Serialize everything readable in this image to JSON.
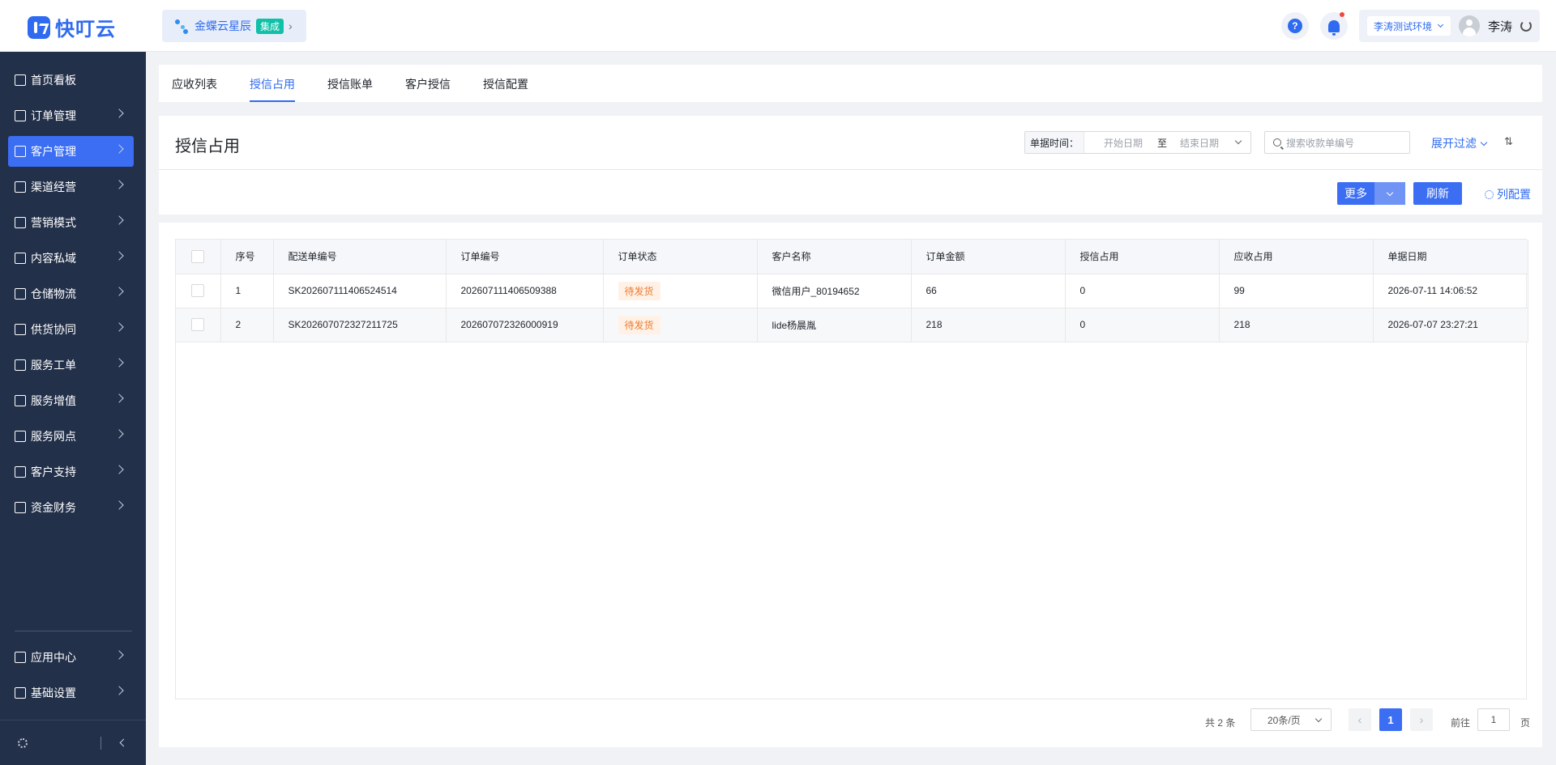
{
  "app": {
    "brand": "快叮云"
  },
  "integration": {
    "name": "金蝶云星辰",
    "badge": "集成"
  },
  "header": {
    "help_icon": "?",
    "environment": "李涛测试环境",
    "user_name": "李涛"
  },
  "sidebar": {
    "items": [
      {
        "label": "首页看板",
        "icon": "home-icon",
        "active": false,
        "has_children": false
      },
      {
        "label": "订单管理",
        "icon": "order-icon",
        "active": false,
        "has_children": true
      },
      {
        "label": "客户管理",
        "icon": "user-icon",
        "active": true,
        "has_children": true
      },
      {
        "label": "渠道经营",
        "icon": "channel-icon",
        "active": false,
        "has_children": true
      },
      {
        "label": "营销模式",
        "icon": "tag-icon",
        "active": false,
        "has_children": true
      },
      {
        "label": "内容私域",
        "icon": "image-icon",
        "active": false,
        "has_children": true
      },
      {
        "label": "仓储物流",
        "icon": "warehouse-icon",
        "active": false,
        "has_children": true
      },
      {
        "label": "供货协同",
        "icon": "supply-icon",
        "active": false,
        "has_children": true
      },
      {
        "label": "服务工单",
        "icon": "workorder-icon",
        "active": false,
        "has_children": true
      },
      {
        "label": "服务增值",
        "icon": "bag-icon",
        "active": false,
        "has_children": true
      },
      {
        "label": "服务网点",
        "icon": "store-icon",
        "active": false,
        "has_children": true
      },
      {
        "label": "客户支持",
        "icon": "support-icon",
        "active": false,
        "has_children": true
      },
      {
        "label": "资金财务",
        "icon": "yuan-icon",
        "active": false,
        "has_children": true
      }
    ],
    "bottom_items": [
      {
        "label": "应用中心",
        "icon": "cube-icon"
      },
      {
        "label": "基础设置",
        "icon": "settings-list-icon"
      }
    ]
  },
  "tabs": [
    {
      "label": "应收列表",
      "active": false
    },
    {
      "label": "授信占用",
      "active": true
    },
    {
      "label": "授信账单",
      "active": false
    },
    {
      "label": "客户授信",
      "active": false
    },
    {
      "label": "授信配置",
      "active": false
    }
  ],
  "page": {
    "title": "授信占用",
    "date_label": "单据时间：",
    "date_start_placeholder": "开始日期",
    "date_separator": "至",
    "date_end_placeholder": "结束日期",
    "search_placeholder": "搜索收款单编号",
    "expand_filter": "展开过滤",
    "more_button": "更多",
    "refresh_button": "刷新",
    "column_config": "列配置"
  },
  "table": {
    "columns": [
      "序号",
      "配送单编号",
      "订单编号",
      "订单状态",
      "客户名称",
      "订单金额",
      "授信占用",
      "应收占用",
      "单据日期"
    ],
    "rows": [
      {
        "index": "1",
        "delivery_no": "SK202607111406524514",
        "order_no": "202607111406509388",
        "status": "待发货",
        "customer": "微信用户_80194652",
        "amount": "66",
        "credit": "0",
        "receivable": "99",
        "date": "2026-07-11 14:06:52"
      },
      {
        "index": "2",
        "delivery_no": "SK202607072327211725",
        "order_no": "202607072326000919",
        "status": "待发货",
        "customer": "lide杨晨胤",
        "amount": "218",
        "credit": "0",
        "receivable": "218",
        "date": "2026-07-07 23:27:21"
      }
    ]
  },
  "pagination": {
    "total_text": "共 2 条",
    "page_size": "20条/页",
    "prev": "‹",
    "current_page": "1",
    "next": "›",
    "goto_label": "前往",
    "goto_value": "1",
    "page_suffix": "页"
  },
  "colors": {
    "primary": "#3b6ef2",
    "sidebar_bg": "#23304a",
    "status_orange": "#ed7b2f"
  }
}
